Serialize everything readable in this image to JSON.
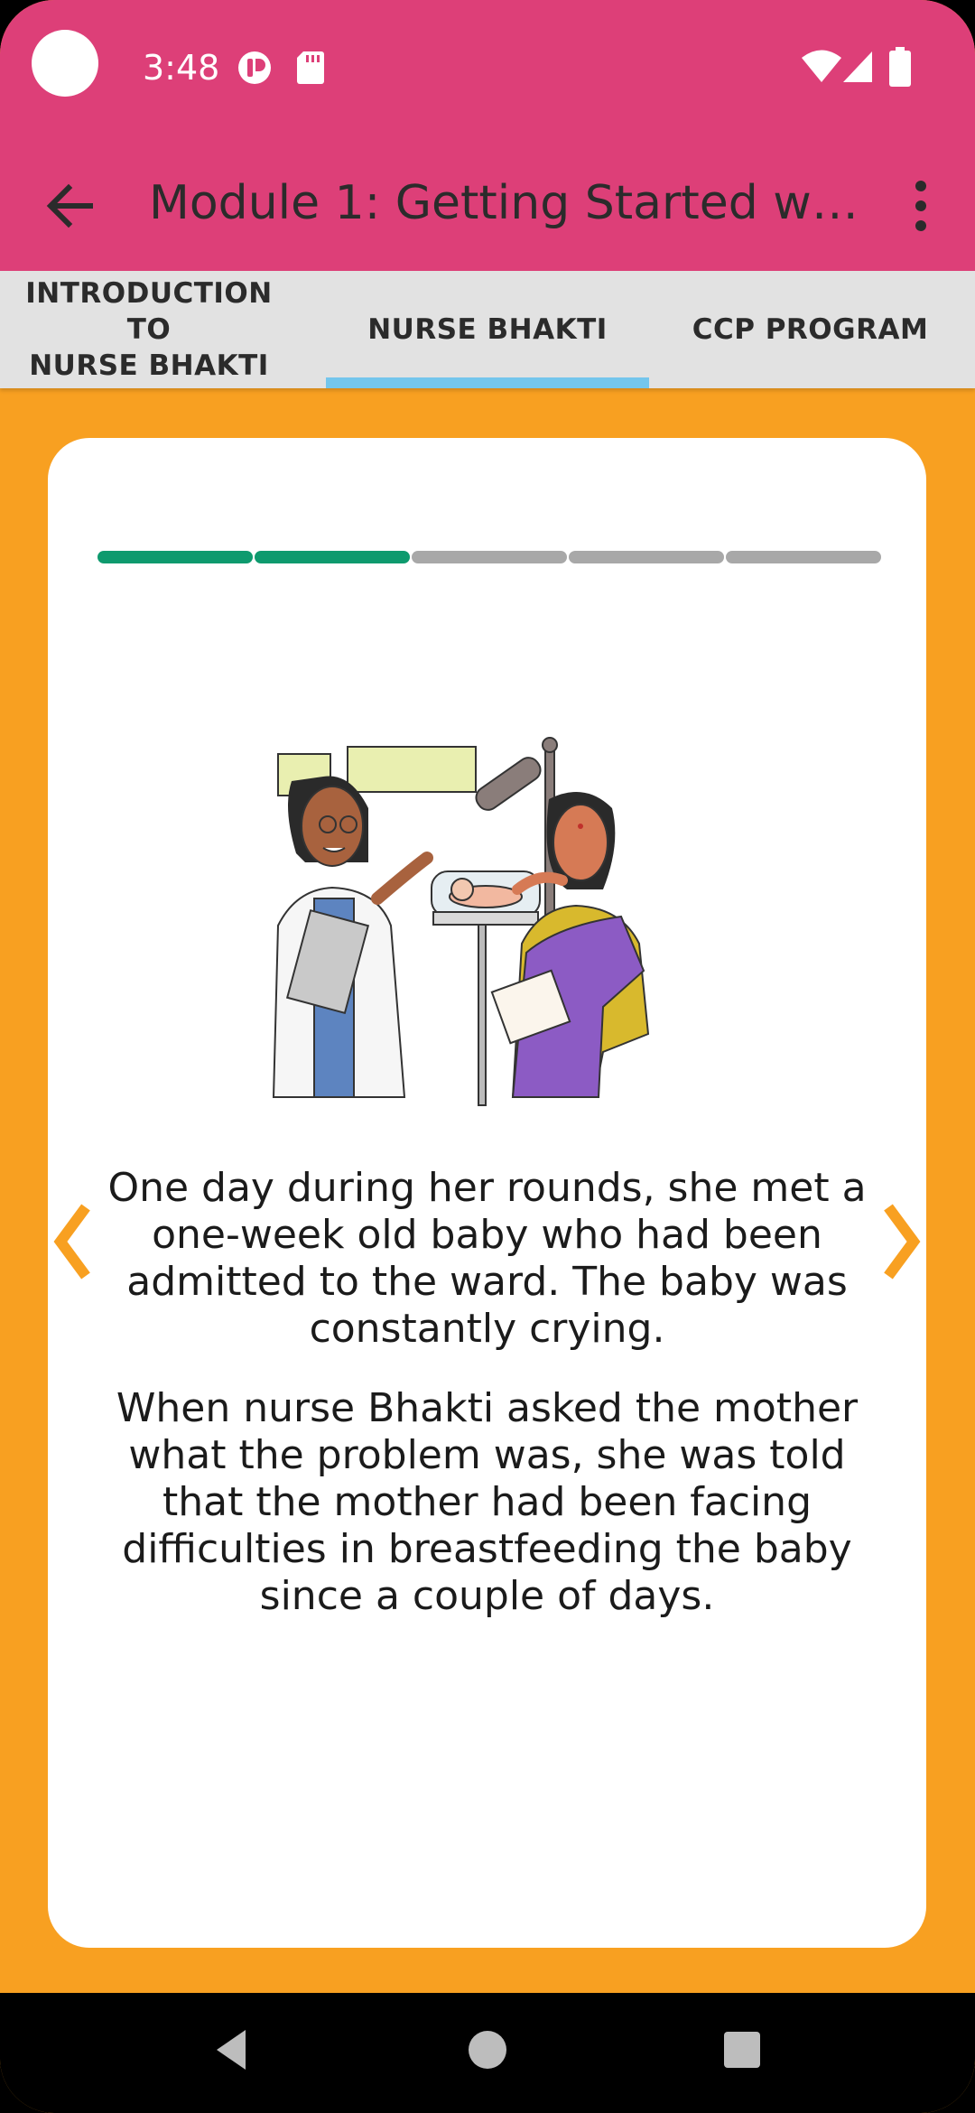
{
  "status_bar": {
    "time": "3:48",
    "left_icons": [
      "notification-app-icon",
      "sd-card-icon"
    ],
    "right_icons": [
      "wifi-icon",
      "cell-signal-icon",
      "battery-icon"
    ]
  },
  "app_bar": {
    "title": "Module 1: Getting Started with...",
    "back_icon": "arrow-left-icon",
    "menu_icon": "more-vertical-icon"
  },
  "tabs": [
    {
      "line1": "INTRODUCTION TO",
      "line2": "NURSE BHAKTI",
      "selected": false
    },
    {
      "line1": "NURSE BHAKTI",
      "line2": "",
      "selected": true
    },
    {
      "line1": "CCP PROGRAM",
      "line2": "",
      "selected": false
    }
  ],
  "story_progress": {
    "completed": 2,
    "total": 5
  },
  "card": {
    "illustration": "doctor-and-mother-with-baby-illustration",
    "paragraphs": [
      "One day during her rounds, she met a one-week old baby who had been admitted to the ward. The baby was constantly crying.",
      "When nurse Bhakti asked the mother what the problem was, she was told that the mother had been facing difficulties in breastfeeding the baby since a couple of days."
    ],
    "prev_icon": "chevron-left-icon",
    "next_icon": "chevron-right-icon"
  },
  "colors": {
    "app_bar": "#DD3F78",
    "background": "#F8A021",
    "tab_indicator": "#74C6EC",
    "progress_done": "#0E9A6E",
    "progress_todo": "#A8A8A8"
  }
}
